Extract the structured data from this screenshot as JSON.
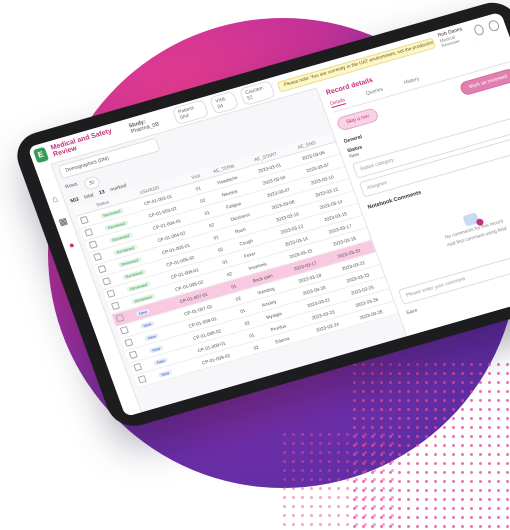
{
  "app": {
    "title": "Medical and Safety Review",
    "study_label": "Study:",
    "study_value": "Pharma_0B"
  },
  "topbar": {
    "chip_1": "Patient: 0A4",
    "chip_2": "Visit: 04",
    "chip_3": "Counter: 52",
    "banner": "Please note: You are currently in the UAT environment, not the production environment.",
    "user_name": "Rob Danes",
    "user_role": "Medical Reviewer"
  },
  "main": {
    "dataset_select": "Demographics (DM)",
    "rows_label": "Rows",
    "rows_value": "30",
    "counts": {
      "total": "503",
      "total_label": "total",
      "selected": "13",
      "selected_label": "marked"
    },
    "columns": [
      "",
      "Status",
      "USUBJID",
      "Visit",
      "AE_TERM",
      "AE_START",
      "AE_END"
    ],
    "rows": [
      [
        "Reviewed",
        "CP-01-003-01",
        "01",
        "Headache",
        "2023-03-01",
        "2023-03-06"
      ],
      [
        "Reviewed",
        "CP-01-003-02",
        "02",
        "Nausea",
        "2023-03-04",
        "2023-03-07"
      ],
      [
        "Reviewed",
        "CP-01-004-01",
        "01",
        "Fatigue",
        "2023-03-07",
        "2023-03-10"
      ],
      [
        "Reviewed",
        "CP-01-004-02",
        "02",
        "Dizziness",
        "2023-03-08",
        "2023-03-12"
      ],
      [
        "Reviewed",
        "CP-01-005-01",
        "01",
        "Rash",
        "2023-03-10",
        "2023-03-14"
      ],
      [
        "Reviewed",
        "CP-01-005-02",
        "02",
        "Cough",
        "2023-03-12",
        "2023-03-15"
      ],
      [
        "Reviewed",
        "CP-01-006-01",
        "01",
        "Fever",
        "2023-03-14",
        "2023-03-17"
      ],
      [
        "Reviewed",
        "CP-01-006-02",
        "02",
        "Insomnia",
        "2023-03-15",
        "2023-03-19"
      ],
      [
        "New",
        "CP-01-007-01",
        "01",
        "Back pain",
        "2023-03-17",
        "2023-03-20"
      ],
      [
        "New",
        "CP-01-007-02",
        "02",
        "Vomiting",
        "2023-03-18",
        "2023-03-22"
      ],
      [
        "New",
        "CP-01-008-01",
        "01",
        "Anxiety",
        "2023-03-20",
        "2023-03-23"
      ],
      [
        "New",
        "CP-01-008-02",
        "02",
        "Myalgia",
        "2023-03-21",
        "2023-03-25"
      ],
      [
        "New",
        "CP-01-009-01",
        "01",
        "Pruritus",
        "2023-03-23",
        "2023-03-26"
      ],
      [
        "New",
        "CP-01-009-02",
        "02",
        "Edema",
        "2023-03-24",
        "2023-03-28"
      ]
    ],
    "selected_row_index": 8
  },
  "panel": {
    "title": "Record details",
    "tabs": [
      "Details",
      "Queries",
      "History"
    ],
    "btn_secondary": "Skip a row",
    "btn_primary": "Mark as reviewed",
    "field_1_label": "General",
    "field_2_label": "Status",
    "field_2_value": "New",
    "status_placeholder": "Status category",
    "assignee_placeholder": "Assignee",
    "comments_head": "Notebook Comments",
    "empty_line_1": "No comments for this record",
    "empty_line_2": "Add first comment using field",
    "comment_placeholder": "Please enter your comment",
    "footer_text": "Save"
  },
  "colors": {
    "brand": "#c2337e",
    "accent_green": "#3a9c5a",
    "selected_row": "#f8c9e0"
  }
}
